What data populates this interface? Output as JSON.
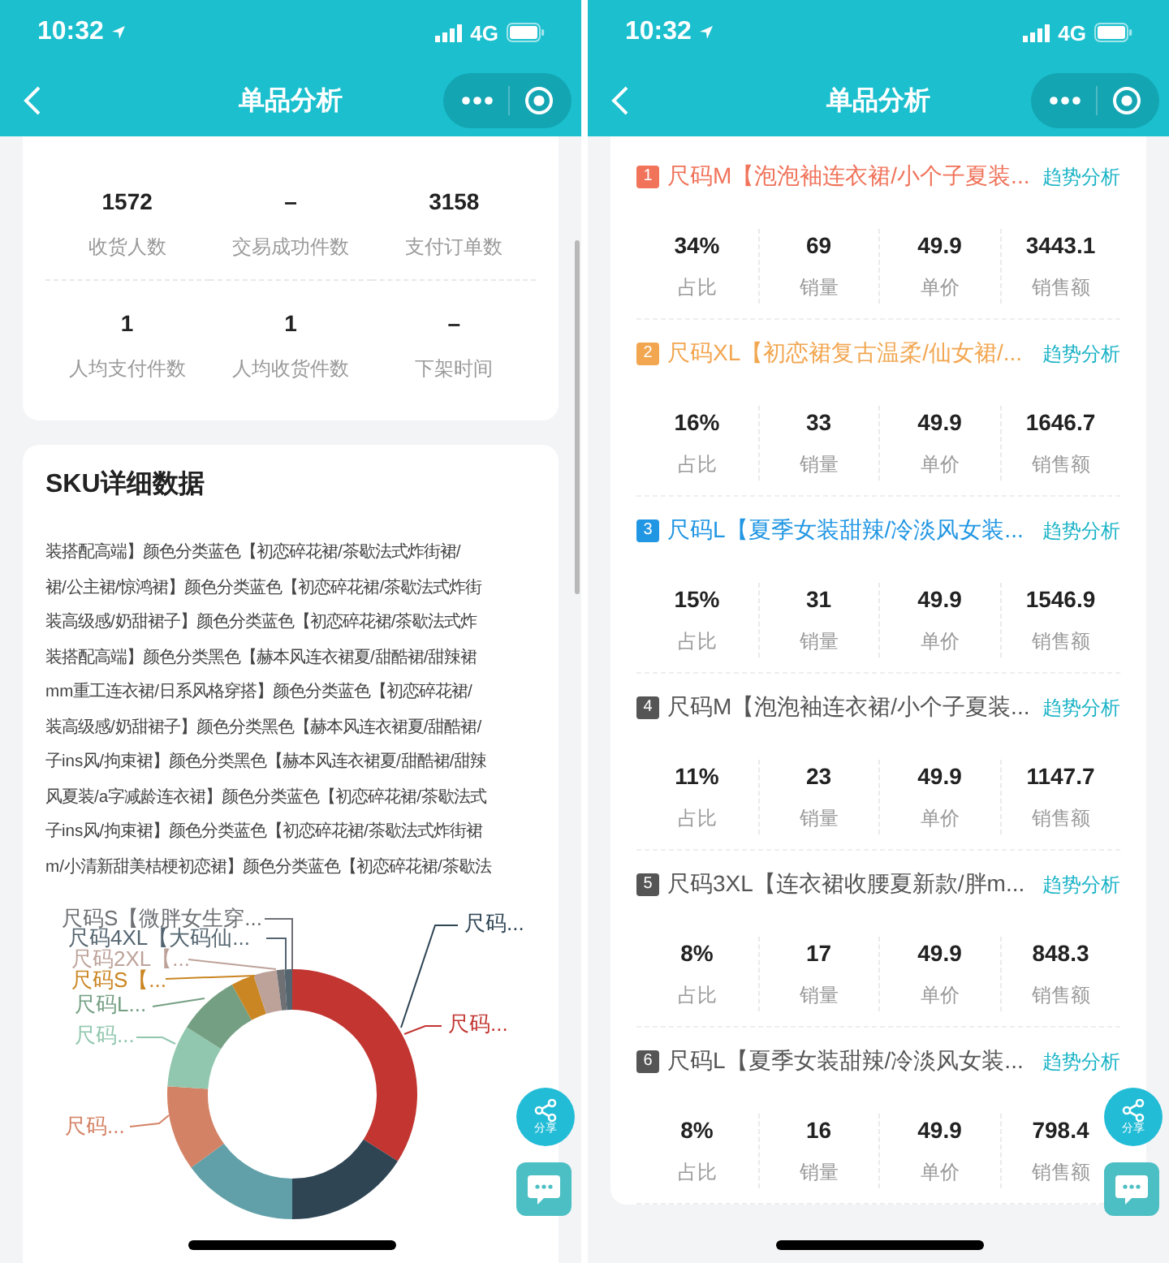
{
  "left_screen": {
    "status_bar": {
      "time": "10:32",
      "network": "4G"
    },
    "nav_bar": {
      "title": "单品分析"
    },
    "summary_stats": [
      {
        "value": "1572",
        "label": "收货人数"
      },
      {
        "value": "–",
        "label": "交易成功件数"
      },
      {
        "value": "3158",
        "label": "支付订单数"
      },
      {
        "value": "1",
        "label": "人均支付件数"
      },
      {
        "value": "1",
        "label": "人均收货件数"
      },
      {
        "value": "–",
        "label": "下架时间"
      }
    ],
    "sku_card": {
      "title": "SKU详细数据",
      "lines": [
        "装搭配高端】颜色分类蓝色【初恋碎花裙/茶歇法式炸街裙/",
        "裙/公主裙/惊鸿裙】颜色分类蓝色【初恋碎花裙/茶歇法式炸街",
        "装高级感/奶甜裙子】颜色分类蓝色【初恋碎花裙/茶歇法式炸",
        "装搭配高端】颜色分类黑色【赫本风连衣裙夏/甜酷裙/甜辣裙",
        "mm重工连衣裙/日系风格穿搭】颜色分类蓝色【初恋碎花裙/",
        "装高级感/奶甜裙子】颜色分类黑色【赫本风连衣裙夏/甜酷裙/",
        "子ins风/拘束裙】颜色分类黑色【赫本风连衣裙夏/甜酷裙/甜辣",
        "风夏装/a字减龄连衣裙】颜色分类蓝色【初恋碎花裙/茶歇法式",
        "子ins风/拘束裙】颜色分类蓝色【初恋碎花裙/茶歇法式炸街裙",
        "m/小清新甜美桔梗初恋裙】颜色分类蓝色【初恋碎花裙/茶歇法"
      ],
      "donut_labels": [
        {
          "text": "尺码S【微胖女生穿...",
          "color": "#6e7074"
        },
        {
          "text": "尺码4XL【大码仙...",
          "color": "#546570"
        },
        {
          "text": "尺码2XL【...",
          "color": "#bda29a"
        },
        {
          "text": "尺码S【...",
          "color": "#ca8622"
        },
        {
          "text": "尺码L...",
          "color": "#749f83"
        },
        {
          "text": "尺码...",
          "color": "#91c7ae"
        },
        {
          "text": "尺码...",
          "color": "#d48265"
        },
        {
          "text": "尺码...",
          "color": "#2f4554"
        },
        {
          "text": "尺码...",
          "color": "#c23531"
        }
      ]
    },
    "share_label": "分享"
  },
  "right_screen": {
    "status_bar": {
      "time": "10:32",
      "network": "4G"
    },
    "nav_bar": {
      "title": "单品分析"
    },
    "sku_list": [
      {
        "rank": "1",
        "name": "尺码M【泡泡袖连衣裙/小个子夏装...",
        "color": "#f0735a",
        "link": "趋势分析",
        "stats": [
          {
            "value": "34%",
            "label": "占比"
          },
          {
            "value": "69",
            "label": "销量"
          },
          {
            "value": "49.9",
            "label": "单价"
          },
          {
            "value": "3443.1",
            "label": "销售额"
          }
        ]
      },
      {
        "rank": "2",
        "name": "尺码XL【初恋裙复古温柔/仙女裙/...",
        "color": "#f2a650",
        "link": "趋势分析",
        "stats": [
          {
            "value": "16%",
            "label": "占比"
          },
          {
            "value": "33",
            "label": "销量"
          },
          {
            "value": "49.9",
            "label": "单价"
          },
          {
            "value": "1646.7",
            "label": "销售额"
          }
        ]
      },
      {
        "rank": "3",
        "name": "尺码L【夏季女装甜辣/冷淡风女装...",
        "color": "#2196e3",
        "link": "趋势分析",
        "stats": [
          {
            "value": "15%",
            "label": "占比"
          },
          {
            "value": "31",
            "label": "销量"
          },
          {
            "value": "49.9",
            "label": "单价"
          },
          {
            "value": "1546.9",
            "label": "销售额"
          }
        ]
      },
      {
        "rank": "4",
        "name": "尺码M【泡泡袖连衣裙/小个子夏装...",
        "color": "#555555",
        "link": "趋势分析",
        "stats": [
          {
            "value": "11%",
            "label": "占比"
          },
          {
            "value": "23",
            "label": "销量"
          },
          {
            "value": "49.9",
            "label": "单价"
          },
          {
            "value": "1147.7",
            "label": "销售额"
          }
        ]
      },
      {
        "rank": "5",
        "name": "尺码3XL【连衣裙收腰夏新款/胖m...",
        "color": "#555555",
        "link": "趋势分析",
        "stats": [
          {
            "value": "8%",
            "label": "占比"
          },
          {
            "value": "17",
            "label": "销量"
          },
          {
            "value": "49.9",
            "label": "单价"
          },
          {
            "value": "848.3",
            "label": "销售额"
          }
        ]
      },
      {
        "rank": "6",
        "name": "尺码L【夏季女装甜辣/冷淡风女装...",
        "color": "#555555",
        "link": "趋势分析",
        "stats": [
          {
            "value": "8%",
            "label": "占比"
          },
          {
            "value": "16",
            "label": "销量"
          },
          {
            "value": "49.9",
            "label": "单价"
          },
          {
            "value": "798.4",
            "label": "销售额"
          }
        ]
      }
    ],
    "share_label": "分享"
  }
}
